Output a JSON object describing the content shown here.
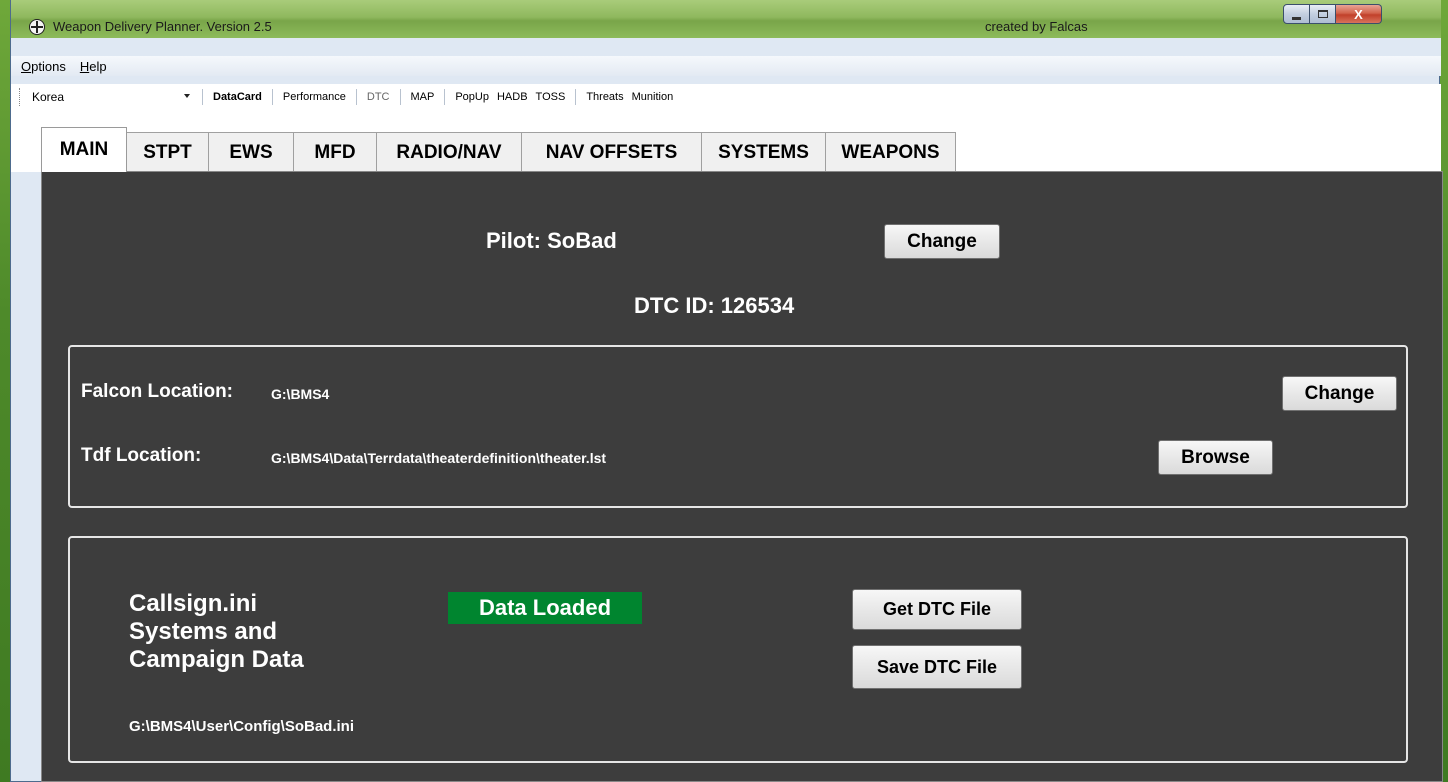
{
  "window": {
    "title": "Weapon Delivery Planner. Version 2.5",
    "credit": "created by Falcas",
    "minimize_icon": "minimize-icon",
    "maximize_icon": "maximize-icon",
    "close_label": "X"
  },
  "menu": {
    "options": {
      "underline": "O",
      "rest": "ptions"
    },
    "help": {
      "underline": "H",
      "rest": "elp"
    }
  },
  "toolbar": {
    "theater_selected": "Korea",
    "buttons": [
      "DataCard",
      "Performance",
      "DTC",
      "MAP",
      "PopUp",
      "HADB",
      "TOSS",
      "Threats",
      "Munition"
    ]
  },
  "tabs": [
    "MAIN",
    "STPT",
    "EWS",
    "MFD",
    "RADIO/NAV",
    "NAV OFFSETS",
    "SYSTEMS",
    "WEAPONS"
  ],
  "main": {
    "pilot_label": "Pilot: SoBad",
    "change_pilot_label": "Change",
    "dtc_id_label": "DTC ID: 126534",
    "falcon_location_label": "Falcon Location:",
    "falcon_location_value": "G:\\BMS4",
    "change_location_label": "Change",
    "tdf_location_label": "Tdf Location:",
    "tdf_location_value": "G:\\BMS4\\Data\\Terrdata\\theaterdefinition\\theater.lst",
    "browse_label": "Browse",
    "data_title_line1": "Callsign.ini",
    "data_title_line2": "Systems and",
    "data_title_line3": "Campaign Data",
    "status": "Data Loaded",
    "get_dtc_label": "Get DTC File",
    "save_dtc_label": "Save DTC File",
    "callsign_path": "G:\\BMS4\\User\\Config\\SoBad.ini"
  },
  "colors": {
    "panel_bg": "#3d3d3d",
    "status_green": "#00852f",
    "desktop_green": "#5d962f"
  }
}
